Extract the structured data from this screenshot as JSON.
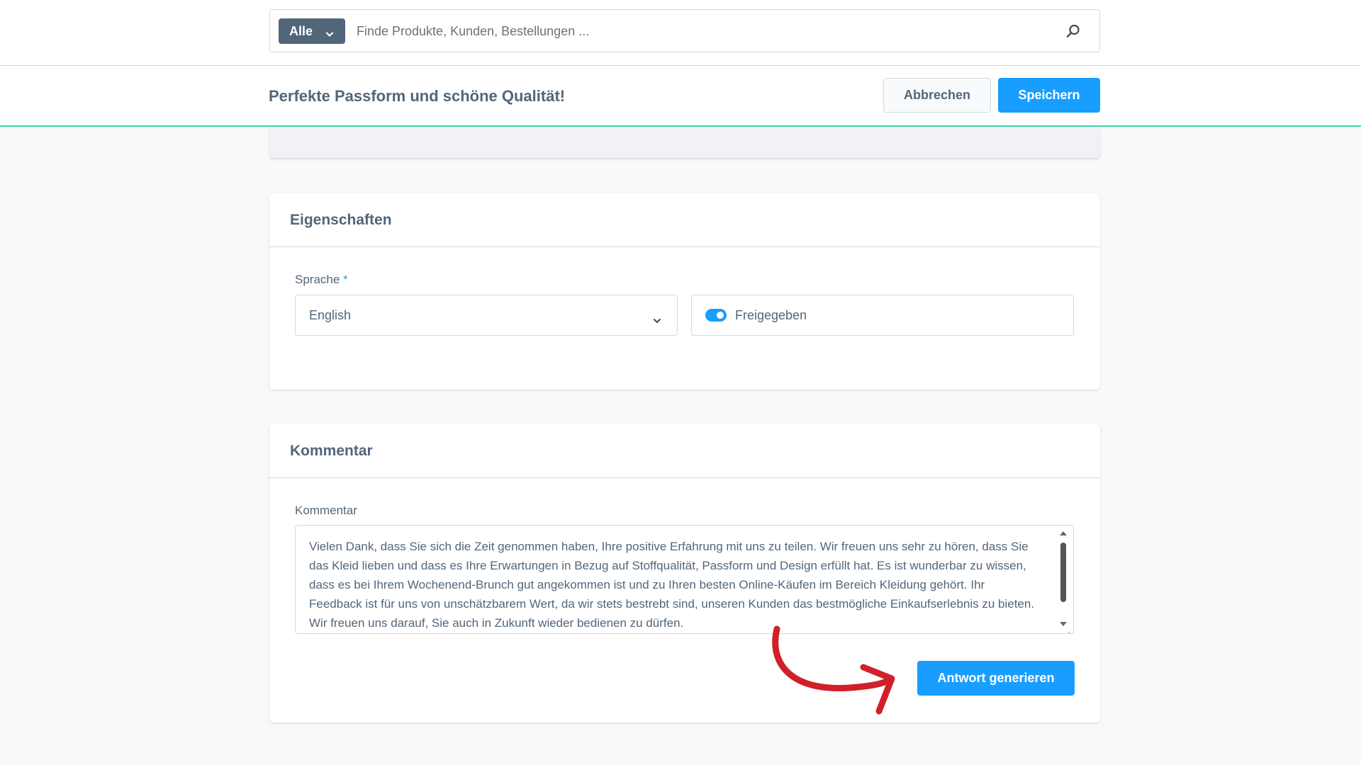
{
  "search": {
    "scope_label": "Alle",
    "placeholder": "Finde Produkte, Kunden, Bestellungen ..."
  },
  "smartbar": {
    "title": "Perfekte Passform und schöne Qualität!",
    "cancel_label": "Abbrechen",
    "save_label": "Speichern"
  },
  "properties": {
    "title": "Eigenschaften",
    "language_label": "Sprache",
    "required_mark": "*",
    "language_value": "English",
    "approved_label": "Freigegeben",
    "approved_on": true
  },
  "comment": {
    "title": "Kommentar",
    "field_label": "Kommentar",
    "text": "Vielen Dank, dass Sie sich die Zeit genommen haben, Ihre positive Erfahrung mit uns zu teilen. Wir freuen uns sehr zu hören, dass Sie das Kleid lieben und dass es Ihre Erwartungen in Bezug auf Stoffqualität, Passform und Design erfüllt hat. Es ist wunderbar zu wissen, dass es bei Ihrem Wochenend-Brunch gut angekommen ist und zu Ihren besten Online-Käufen im Bereich Kleidung gehört. Ihr Feedback ist für uns von unschätzbarem Wert, da wir stets bestrebt sind, unseren Kunden das bestmögliche Einkaufserlebnis zu bieten. Wir freuen uns darauf, Sie auch in Zukunft wieder bedienen zu dürfen.",
    "generate_label": "Antwort generieren"
  },
  "icons": {
    "scope_chevron": "chevron-down-icon",
    "search": "search-icon",
    "select_chevron": "chevron-down-icon",
    "annotation": "curved-arrow-icon"
  },
  "colors": {
    "primary": "#189eff",
    "text": "#52667a",
    "accent_line": "#37d4a9",
    "annotation_arrow": "#d0202a"
  }
}
